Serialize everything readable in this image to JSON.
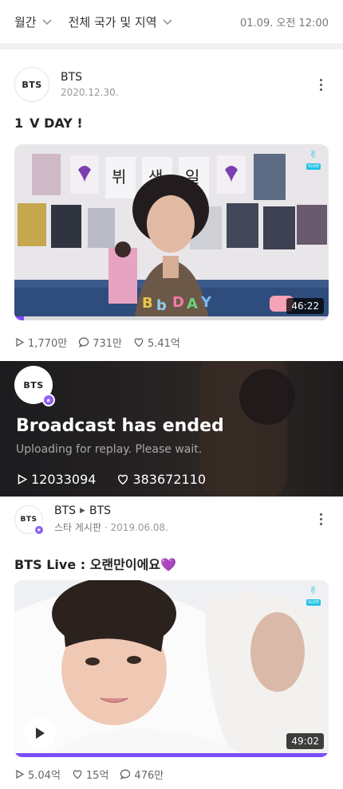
{
  "filters": {
    "period": "월간",
    "region": "전체 국가 및 지역",
    "timestamp": "01.09. 오전 12:00"
  },
  "post1": {
    "avatar_text": "BTS",
    "author": "BTS",
    "date": "2020.12.30.",
    "rank": "1",
    "title": "V DAY !",
    "duration": "46:22",
    "vlive_label": "VLIVE",
    "plays": "1,770만",
    "comments": "731만",
    "likes": "5.41억",
    "progress_fraction": 0.03
  },
  "broadcast": {
    "avatar_text": "BTS",
    "title": "Broadcast has ended",
    "subtitle": "Uploading for replay. Please wait.",
    "plays": "12033094",
    "likes": "383672110"
  },
  "post2": {
    "avatar_text": "BTS",
    "author": "BTS",
    "author_target": "BTS",
    "board": "스타 게시판",
    "date": "2019.06.08.",
    "title": "BTS Live : 오랜만이에요💜",
    "duration": "49:02",
    "vlive_label": "VLIVE",
    "plays": "5.04억",
    "likes": "15억",
    "comments": "476만",
    "progress_fraction": 1.0
  },
  "colors": {
    "accent": "#7c4dff",
    "vlive": "#22c3e6",
    "badge": "#8b5cf6"
  }
}
